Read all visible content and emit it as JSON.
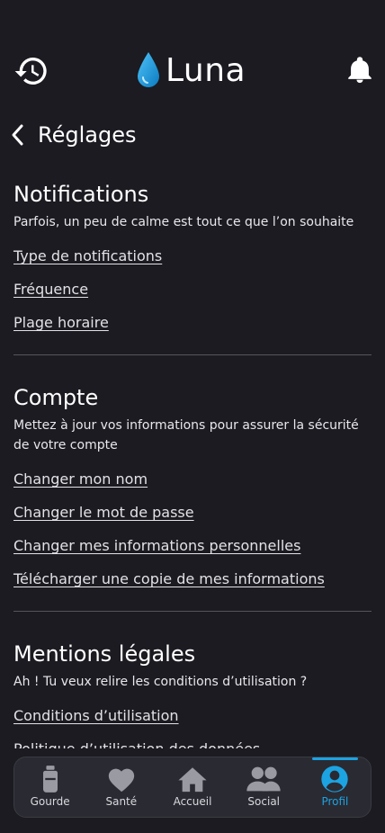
{
  "app": {
    "name": "Luna"
  },
  "page": {
    "title": "Réglages"
  },
  "sections": {
    "notifications": {
      "title": "Notifications",
      "description": "Parfois, un peu de calme est tout ce que l’on souhaite",
      "links": [
        "Type de notifications",
        "Fréquence",
        "Plage horaire"
      ]
    },
    "account": {
      "title": "Compte",
      "description": "Mettez à jour vos informations pour assurer la sécurité de votre compte",
      "links": [
        "Changer mon nom",
        "Changer le mot de passe",
        "Changer mes informations personnelles",
        "Télécharger une copie de mes informations"
      ]
    },
    "legal": {
      "title": "Mentions légales",
      "description": "Ah ! Tu veux relire les conditions d’utilisation ?",
      "links": [
        "Conditions d’utilisation",
        "Politique d’utilisation des données"
      ]
    }
  },
  "nav": {
    "items": [
      {
        "label": "Gourde",
        "icon": "bottle-icon"
      },
      {
        "label": "Santé",
        "icon": "heart-icon"
      },
      {
        "label": "Accueil",
        "icon": "home-icon"
      },
      {
        "label": "Social",
        "icon": "people-icon"
      },
      {
        "label": "Profil",
        "icon": "profile-icon",
        "active": true
      }
    ]
  },
  "colors": {
    "background": "#1b1b21",
    "accent": "#1ca3e2",
    "navBg": "#2a2a32"
  }
}
